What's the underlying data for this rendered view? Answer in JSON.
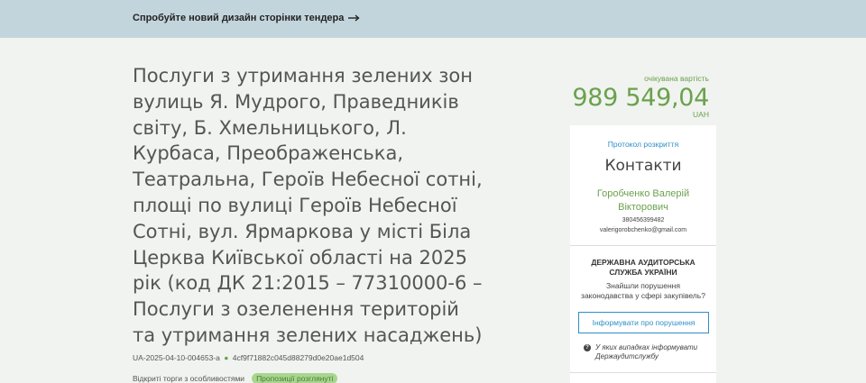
{
  "banner": {
    "link_text": "Спробуйте новий дизайн сторінки тендера"
  },
  "tender": {
    "title": "Послуги з утримання зелених зон вулиць Я. Мудрого, Праведників світу, Б. Хмельницького, Л. Курбаса, Преображенська, Театральна, Героїв Небесної сотні, площі по вулиці Героїв Небесної Сотні, вул. Ярмаркова у місті Біла Церква Київської області на 2025 рік (код ДК 21:2015 – 77310000-6 – Послуги з озеленення територій та утримання зелених насаджень)",
    "id": "UA-2025-04-10-004653-a",
    "hash": "4cf9f71882c045d88279d0e20ae1d504",
    "procedure": "Відкриті торги з особливостями",
    "status": "Пропозиції розглянуті"
  },
  "price": {
    "label": "очікувана вартість",
    "value": "989 549,04",
    "currency": "UAH"
  },
  "contacts": {
    "protocol_link": "Протокол розкриття",
    "title": "Контакти",
    "name_line1": "Горобченко Валерій",
    "name_line2": "Вікторович",
    "phone": "380456399482",
    "email": "valerigorobchenko@gmail.com"
  },
  "audit": {
    "title_line1": "ДЕРЖАВНА АУДИТОРСЬКА",
    "title_line2": "СЛУЖБА УКРАЇНИ",
    "text_line1": "Знайшли порушення",
    "text_line2": "законодавства у сфері закупівель?",
    "button_label": "Інформувати про порушення",
    "info_line1": "У яких випадках інформувати",
    "info_line2": "Держаудитслужбу"
  },
  "colors": {
    "accent_green": "#6ba14e",
    "link_blue": "#2f8fc6",
    "banner_bg": "#c3d5dc",
    "page_bg": "#f0f3ef"
  }
}
